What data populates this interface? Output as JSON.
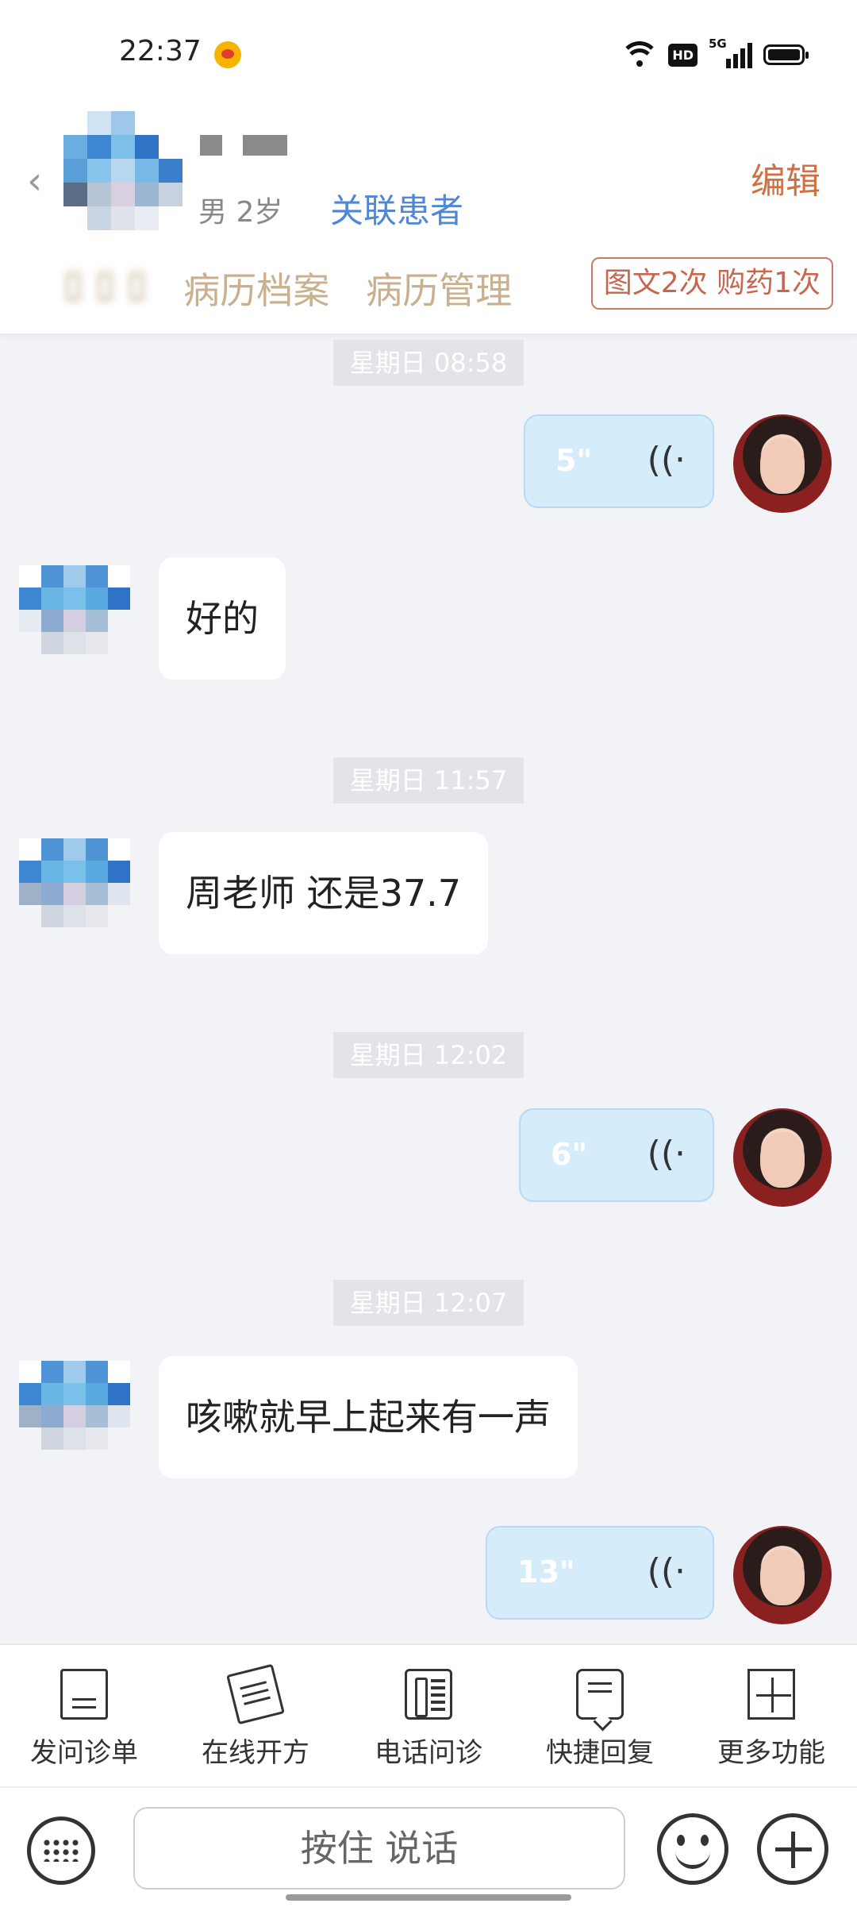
{
  "status_bar": {
    "time": "22:37",
    "hd_label": "HD",
    "network_label": "5G"
  },
  "header": {
    "patient_meta": "男 2岁",
    "link_patient": "关联患者",
    "edit": "编辑",
    "tabs": [
      "病历档案",
      "病历管理"
    ],
    "usage_badge": "图文2次 购药1次"
  },
  "chat": {
    "timestamps": [
      "星期日 08:58",
      "星期日 11:57",
      "星期日 12:02",
      "星期日 12:07"
    ],
    "voice_messages": [
      "5\"",
      "6\"",
      "13\""
    ],
    "patient_messages": [
      "好的",
      "周老师 还是37.7",
      "咳嗽就早上起来有一声"
    ]
  },
  "toolbar": {
    "items": [
      "发问诊单",
      "在线开方",
      "电话问诊",
      "快捷回复",
      "更多功能"
    ]
  },
  "input": {
    "hold_to_talk": "按住 说话"
  },
  "colors": {
    "accent_blue": "#4f86d6",
    "edit_orange": "#d07045",
    "voice_bubble": "#d5ecfb",
    "chat_bg": "#f2f3f7"
  }
}
